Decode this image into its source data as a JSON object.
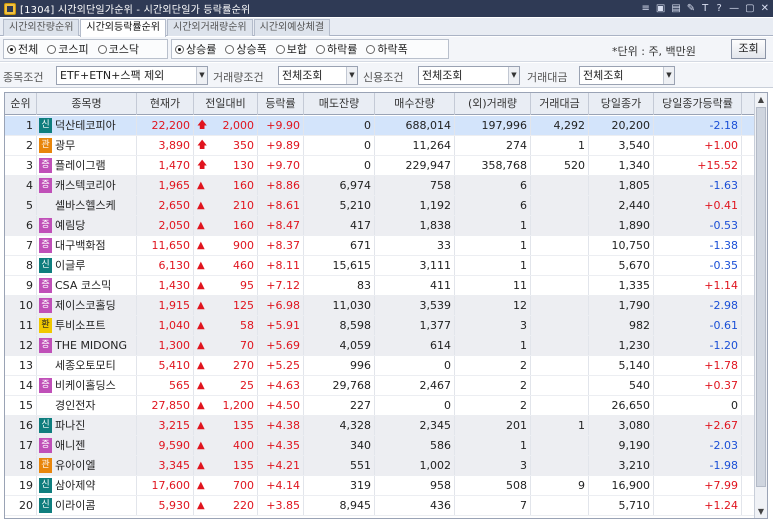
{
  "window": {
    "title": "[1304] 시간외단일가순위 - 시간외단일가 등락률순위",
    "controls": [
      "≡",
      "▣",
      "▤",
      "✎",
      "T",
      "?",
      "—",
      "▢",
      "✕"
    ]
  },
  "tabs": [
    {
      "label": "시간외잔량순위",
      "active": false
    },
    {
      "label": "시간외등락률순위",
      "active": true
    },
    {
      "label": "시간외거래량순위",
      "active": false
    },
    {
      "label": "시간외예상체결",
      "active": false
    }
  ],
  "market_filter": [
    {
      "label": "전체",
      "checked": true
    },
    {
      "label": "코스피",
      "checked": false
    },
    {
      "label": "코스닥",
      "checked": false
    }
  ],
  "rank_type": [
    {
      "label": "상승률",
      "checked": true
    },
    {
      "label": "상승폭",
      "checked": false
    },
    {
      "label": "보합",
      "checked": false
    },
    {
      "label": "하락률",
      "checked": false
    },
    {
      "label": "하락폭",
      "checked": false
    }
  ],
  "unit_label": "*단위 : 주, 백만원",
  "query_button": "조회",
  "filters": {
    "item_label": "종목조건",
    "item_value": "ETF+ETN+스팩 제외",
    "volume_label": "거래량조건",
    "volume_value": "전체조회",
    "credit_label": "신용조건",
    "credit_value": "전체조회",
    "amount_label": "거래대금",
    "amount_value": "전체조회"
  },
  "columns": [
    "순위",
    "종목명",
    "현재가",
    "전일대비",
    "등락률",
    "매도잔량",
    "매수잔량",
    "(외)거래량",
    "거래대금",
    "당일종가",
    "당일종가등락률"
  ],
  "badge_colors": {
    "신": "#0f7e7e",
    "관": "#e8860c",
    "증": "#c050b8",
    "환": "#f0c800"
  },
  "rows": [
    {
      "rank": "1",
      "badge": "신",
      "name": "덕산테코피아",
      "price": "22,200",
      "sym": "🡅",
      "diff": "2,000",
      "rate": "+9.90",
      "sell": "0",
      "buy": "688,014",
      "vol": "197,996",
      "amount": "4,292",
      "close": "20,200",
      "close_rate": "-2.18",
      "cr_color": "blue"
    },
    {
      "rank": "2",
      "badge": "관",
      "name": "광무",
      "price": "3,890",
      "sym": "🡅",
      "diff": "350",
      "rate": "+9.89",
      "sell": "0",
      "buy": "11,264",
      "vol": "274",
      "amount": "1",
      "close": "3,540",
      "close_rate": "+1.00",
      "cr_color": "red"
    },
    {
      "rank": "3",
      "badge": "증",
      "name": "플레이그램",
      "price": "1,470",
      "sym": "🡅",
      "diff": "130",
      "rate": "+9.70",
      "sell": "0",
      "buy": "229,947",
      "vol": "358,768",
      "amount": "520",
      "close": "1,340",
      "close_rate": "+15.52",
      "cr_color": "red"
    },
    {
      "rank": "4",
      "badge": "증",
      "name": "캐스텍코리아",
      "price": "1,965",
      "sym": "▲",
      "diff": "160",
      "rate": "+8.86",
      "sell": "6,974",
      "buy": "758",
      "vol": "6",
      "amount": "",
      "close": "1,805",
      "close_rate": "-1.63",
      "cr_color": "blue"
    },
    {
      "rank": "5",
      "badge": "",
      "name": "셀바스헬스케",
      "price": "2,650",
      "sym": "▲",
      "diff": "210",
      "rate": "+8.61",
      "sell": "5,210",
      "buy": "1,192",
      "vol": "6",
      "amount": "",
      "close": "2,440",
      "close_rate": "+0.41",
      "cr_color": "red"
    },
    {
      "rank": "6",
      "badge": "증",
      "name": "예림당",
      "price": "2,050",
      "sym": "▲",
      "diff": "160",
      "rate": "+8.47",
      "sell": "417",
      "buy": "1,838",
      "vol": "1",
      "amount": "",
      "close": "1,890",
      "close_rate": "-0.53",
      "cr_color": "blue"
    },
    {
      "rank": "7",
      "badge": "증",
      "name": "대구백화점",
      "price": "11,650",
      "sym": "▲",
      "diff": "900",
      "rate": "+8.37",
      "sell": "671",
      "buy": "33",
      "vol": "1",
      "amount": "",
      "close": "10,750",
      "close_rate": "-1.38",
      "cr_color": "blue"
    },
    {
      "rank": "8",
      "badge": "신",
      "name": "이글루",
      "price": "6,130",
      "sym": "▲",
      "diff": "460",
      "rate": "+8.11",
      "sell": "15,615",
      "buy": "3,111",
      "vol": "1",
      "amount": "",
      "close": "5,670",
      "close_rate": "-0.35",
      "cr_color": "blue"
    },
    {
      "rank": "9",
      "badge": "증",
      "name": "CSA 코스믹",
      "price": "1,430",
      "sym": "▲",
      "diff": "95",
      "rate": "+7.12",
      "sell": "83",
      "buy": "411",
      "vol": "11",
      "amount": "",
      "close": "1,335",
      "close_rate": "+1.14",
      "cr_color": "red"
    },
    {
      "rank": "10",
      "badge": "증",
      "name": "제이스코홀딩",
      "price": "1,915",
      "sym": "▲",
      "diff": "125",
      "rate": "+6.98",
      "sell": "11,030",
      "buy": "3,539",
      "vol": "12",
      "amount": "",
      "close": "1,790",
      "close_rate": "-2.98",
      "cr_color": "blue"
    },
    {
      "rank": "11",
      "badge": "환",
      "name": "투비소프트",
      "price": "1,040",
      "sym": "▲",
      "diff": "58",
      "rate": "+5.91",
      "sell": "8,598",
      "buy": "1,377",
      "vol": "3",
      "amount": "",
      "close": "982",
      "close_rate": "-0.61",
      "cr_color": "blue"
    },
    {
      "rank": "12",
      "badge": "증",
      "name": "THE MIDONG",
      "price": "1,300",
      "sym": "▲",
      "diff": "70",
      "rate": "+5.69",
      "sell": "4,059",
      "buy": "614",
      "vol": "1",
      "amount": "",
      "close": "1,230",
      "close_rate": "-1.20",
      "cr_color": "blue"
    },
    {
      "rank": "13",
      "badge": "",
      "name": "세종오토모티",
      "price": "5,410",
      "sym": "▲",
      "diff": "270",
      "rate": "+5.25",
      "sell": "996",
      "buy": "0",
      "vol": "2",
      "amount": "",
      "close": "5,140",
      "close_rate": "+1.78",
      "cr_color": "red"
    },
    {
      "rank": "14",
      "badge": "증",
      "name": "비케이홀딩스",
      "price": "565",
      "sym": "▲",
      "diff": "25",
      "rate": "+4.63",
      "sell": "29,768",
      "buy": "2,467",
      "vol": "2",
      "amount": "",
      "close": "540",
      "close_rate": "+0.37",
      "cr_color": "red"
    },
    {
      "rank": "15",
      "badge": "",
      "name": "경인전자",
      "price": "27,850",
      "sym": "▲",
      "diff": "1,200",
      "rate": "+4.50",
      "sell": "227",
      "buy": "0",
      "vol": "2",
      "amount": "",
      "close": "26,650",
      "close_rate": "0",
      "cr_color": "black"
    },
    {
      "rank": "16",
      "badge": "신",
      "name": "파나진",
      "price": "3,215",
      "sym": "▲",
      "diff": "135",
      "rate": "+4.38",
      "sell": "4,328",
      "buy": "2,345",
      "vol": "201",
      "amount": "1",
      "close": "3,080",
      "close_rate": "+2.67",
      "cr_color": "red"
    },
    {
      "rank": "17",
      "badge": "증",
      "name": "애니젠",
      "price": "9,590",
      "sym": "▲",
      "diff": "400",
      "rate": "+4.35",
      "sell": "340",
      "buy": "586",
      "vol": "1",
      "amount": "",
      "close": "9,190",
      "close_rate": "-2.03",
      "cr_color": "blue"
    },
    {
      "rank": "18",
      "badge": "관",
      "name": "유아이엘",
      "price": "3,345",
      "sym": "▲",
      "diff": "135",
      "rate": "+4.21",
      "sell": "551",
      "buy": "1,002",
      "vol": "3",
      "amount": "",
      "close": "3,210",
      "close_rate": "-1.98",
      "cr_color": "blue"
    },
    {
      "rank": "19",
      "badge": "신",
      "name": "삼아제약",
      "price": "17,600",
      "sym": "▲",
      "diff": "700",
      "rate": "+4.14",
      "sell": "319",
      "buy": "958",
      "vol": "508",
      "amount": "9",
      "close": "16,900",
      "close_rate": "+7.99",
      "cr_color": "red"
    },
    {
      "rank": "20",
      "badge": "신",
      "name": "이라이콤",
      "price": "5,930",
      "sym": "▲",
      "diff": "220",
      "rate": "+3.85",
      "sell": "8,945",
      "buy": "436",
      "vol": "7",
      "amount": "",
      "close": "5,710",
      "close_rate": "+1.24",
      "cr_color": "red"
    }
  ]
}
